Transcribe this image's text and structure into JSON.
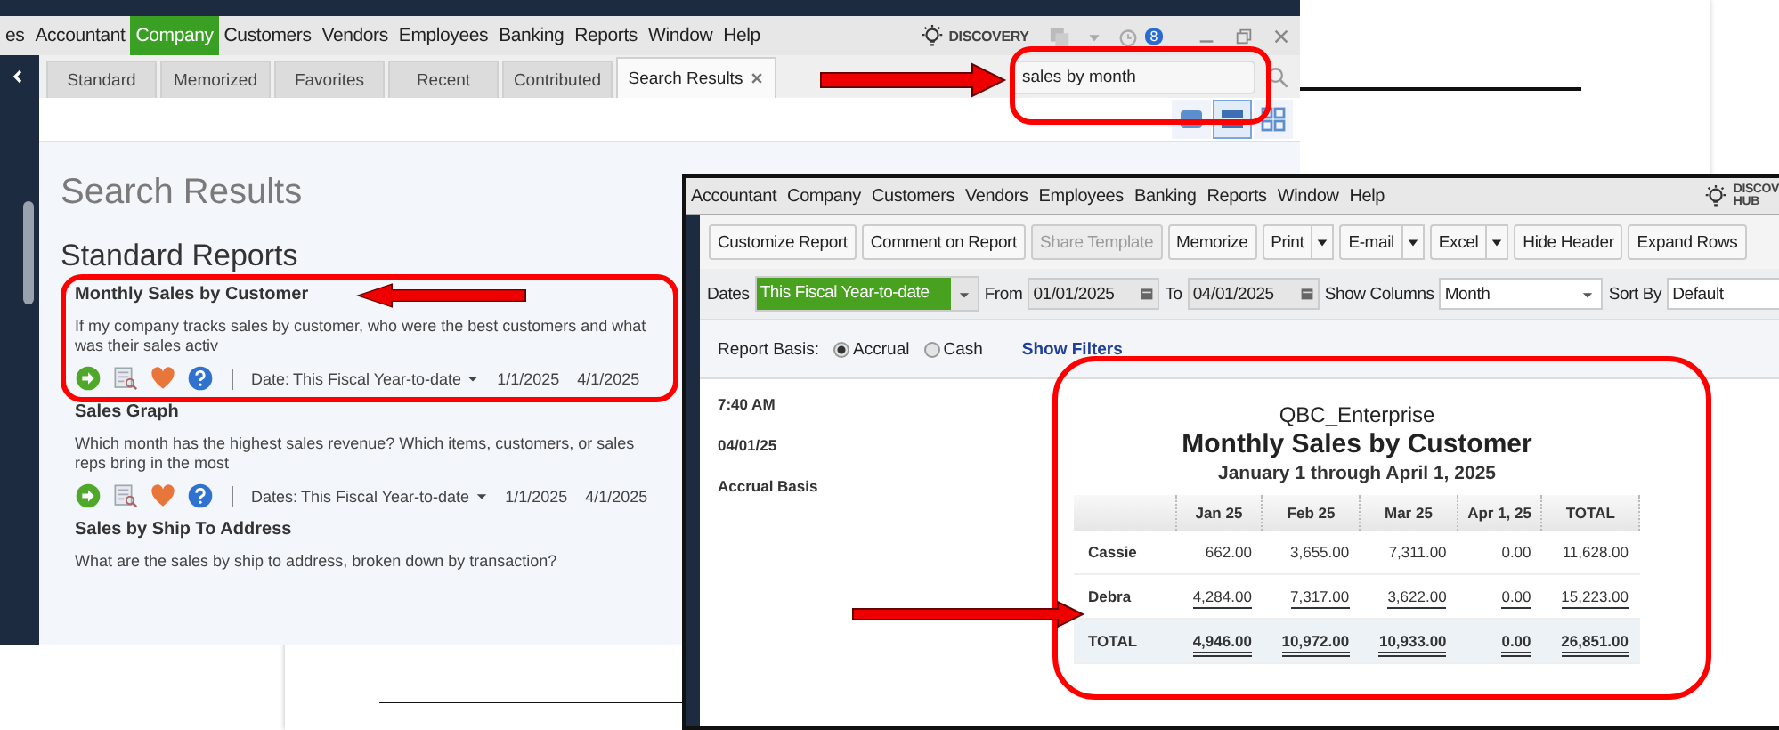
{
  "search_window": {
    "menu": [
      {
        "label": "es",
        "selected": false
      },
      {
        "label": "Accountant",
        "selected": false
      },
      {
        "label": "Company",
        "selected": true
      },
      {
        "label": "Customers",
        "selected": false
      },
      {
        "label": "Vendors",
        "selected": false
      },
      {
        "label": "Employees",
        "selected": false
      },
      {
        "label": "Banking",
        "selected": false
      },
      {
        "label": "Reports",
        "selected": false
      },
      {
        "label": "Window",
        "selected": false
      },
      {
        "label": "Help",
        "selected": false
      }
    ],
    "discovery_hub": "DISCOVERY",
    "notification_count": "8",
    "tabs": [
      {
        "label": "Standard",
        "selected": false
      },
      {
        "label": "Memorized",
        "selected": false
      },
      {
        "label": "Favorites",
        "selected": false
      },
      {
        "label": "Recent",
        "selected": false
      },
      {
        "label": "Contributed",
        "selected": false
      },
      {
        "label": "Search Results",
        "selected": true
      }
    ],
    "search": {
      "value": "sales by month"
    },
    "view_modes": [
      {
        "selected": false
      },
      {
        "selected": true
      },
      {
        "selected": false
      }
    ],
    "heading": "Search Results",
    "section": "Standard Reports",
    "reports": [
      {
        "title": "Monthly Sales by Customer",
        "description": "If my company tracks sales by customer, who were the best customers and what was their sales activ",
        "date_label": "Date:",
        "date_range": "This Fiscal Year-to-date",
        "from": "1/1/2025",
        "to": "4/1/2025"
      },
      {
        "title": "Sales Graph",
        "description": "Which month has the highest sales revenue? Which items, customers, or sales reps bring in the most",
        "date_label": "Dates:",
        "date_range": "This Fiscal Year-to-date",
        "from": "1/1/2025",
        "to": "4/1/2025"
      },
      {
        "title": "Sales by Ship To Address",
        "description": "What are the sales by ship to address, broken down by transaction?"
      }
    ]
  },
  "report_window": {
    "menu": [
      "Accountant",
      "Company",
      "Customers",
      "Vendors",
      "Employees",
      "Banking",
      "Reports",
      "Window",
      "Help"
    ],
    "discovery_hub": [
      "DISCOV",
      "HUB"
    ],
    "toolbar": [
      {
        "label": "Customize Report",
        "disabled": false,
        "dropdown": false
      },
      {
        "label": "Comment on Report",
        "disabled": false,
        "dropdown": false
      },
      {
        "label": "Share Template",
        "disabled": true,
        "dropdown": false
      },
      {
        "label": "Memorize",
        "disabled": false,
        "dropdown": false
      },
      {
        "label": "Print",
        "disabled": false,
        "dropdown": true
      },
      {
        "label": "E-mail",
        "disabled": false,
        "dropdown": true
      },
      {
        "label": "Excel",
        "disabled": false,
        "dropdown": true
      },
      {
        "label": "Hide Header",
        "disabled": false,
        "dropdown": false
      },
      {
        "label": "Expand Rows",
        "disabled": false,
        "dropdown": false
      }
    ],
    "dates_label": "Dates",
    "dates_value": "This Fiscal Year-to-date",
    "from_label": "From",
    "from": "01/01/2025",
    "to_label": "To",
    "to": "04/01/2025",
    "columns_label": "Show Columns",
    "columns_value": "Month",
    "sort_label": "Sort By",
    "sort_value": "Default",
    "basis_label": "Report Basis:",
    "basis_options": [
      {
        "label": "Accrual",
        "selected": true
      },
      {
        "label": "Cash",
        "selected": false
      }
    ],
    "filters_link": "Show Filters",
    "header_info": [
      "7:40 AM",
      "04/01/25",
      "Accrual Basis"
    ],
    "company": "QBC_Enterprise",
    "title": "Monthly Sales by Customer",
    "period": "January 1 through April 1, 2025",
    "table": {
      "columns": [
        "Jan 25",
        "Feb 25",
        "Mar 25",
        "Apr 1, 25",
        "TOTAL"
      ],
      "rows": [
        {
          "name": "Cassie",
          "kind": "detail",
          "values": [
            "662.00",
            "3,655.00",
            "7,311.00",
            "0.00",
            "11,628.00"
          ]
        },
        {
          "name": "Debra",
          "kind": "detail",
          "values": [
            "4,284.00",
            "7,317.00",
            "3,622.00",
            "0.00",
            "15,223.00"
          ]
        },
        {
          "name": "TOTAL",
          "kind": "total",
          "values": [
            "4,946.00",
            "10,972.00",
            "10,933.00",
            "0.00",
            "26,851.00"
          ]
        }
      ]
    }
  }
}
